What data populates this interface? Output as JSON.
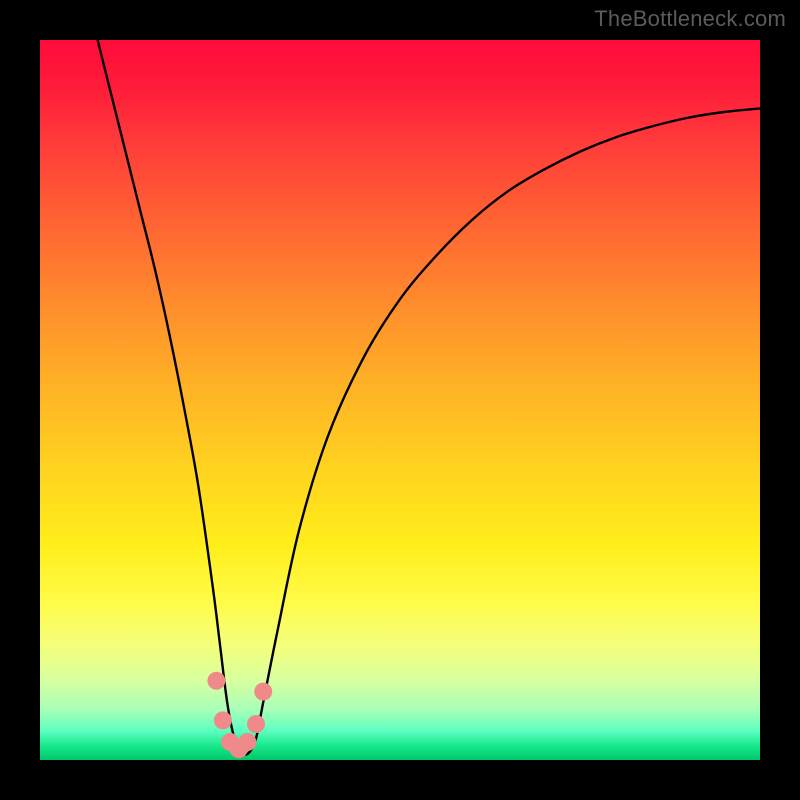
{
  "watermark": "TheBottleneck.com",
  "chart_data": {
    "type": "line",
    "title": "",
    "xlabel": "",
    "ylabel": "",
    "xlim": [
      0,
      100
    ],
    "ylim": [
      0,
      100
    ],
    "grid": false,
    "legend": false,
    "series": [
      {
        "name": "curve",
        "x": [
          8,
          10,
          12,
          14,
          16,
          18,
          20,
          22,
          24,
          25,
          26,
          27,
          28,
          29,
          30,
          31,
          33,
          36,
          40,
          45,
          50,
          55,
          60,
          65,
          70,
          75,
          80,
          85,
          90,
          95,
          100
        ],
        "y": [
          100,
          92,
          84,
          76,
          68,
          59,
          49,
          38,
          24,
          16,
          8,
          3,
          1,
          1,
          3,
          8,
          18,
          32,
          45,
          56,
          64,
          70,
          75,
          79,
          82,
          84.5,
          86.5,
          88,
          89.2,
          90,
          90.5
        ]
      }
    ],
    "markers": {
      "name": "low-band-dots",
      "color": "#f08a8a",
      "radius_px": 9,
      "x": [
        24.5,
        25.4,
        26.4,
        27.6,
        28.8,
        30.0,
        31.0
      ],
      "y": [
        11,
        5.5,
        2.5,
        1.5,
        2.5,
        5.0,
        9.5
      ]
    },
    "background_gradient": {
      "top": "#ff0b3b",
      "mid": "#ffd41f",
      "bottom": "#00c66a"
    }
  }
}
